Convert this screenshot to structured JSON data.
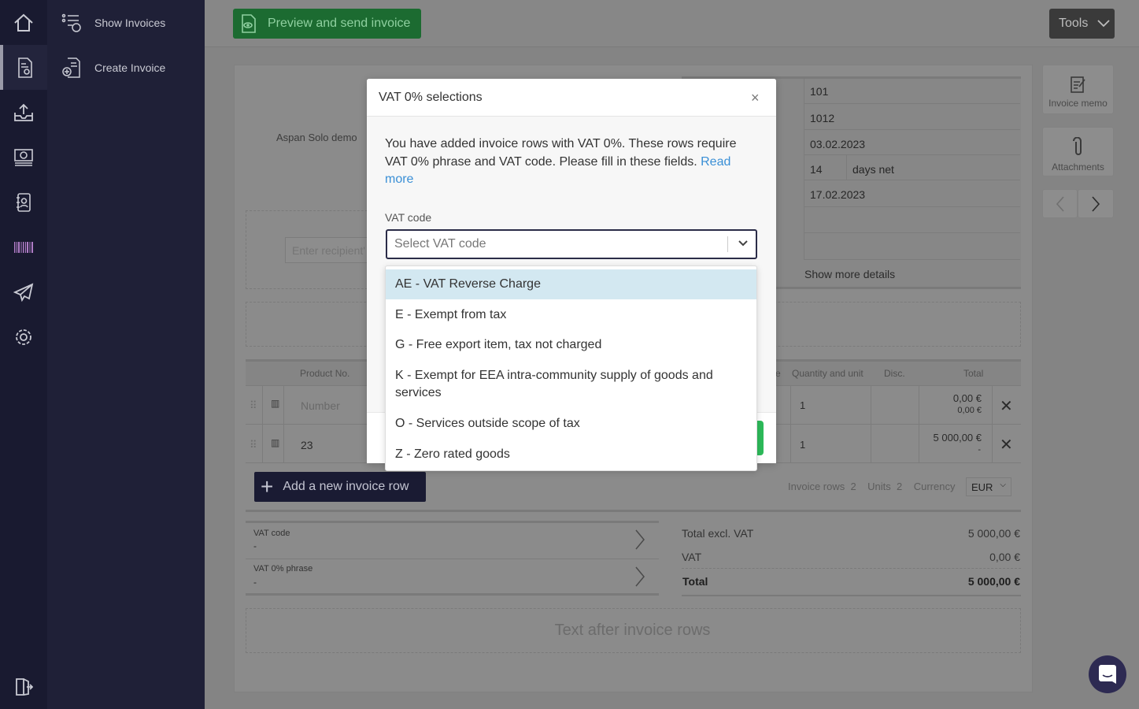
{
  "nav": {
    "rail": [
      "home",
      "invoices",
      "inbox-upload",
      "money",
      "contacts",
      "barcode",
      "send",
      "settings",
      "logout"
    ],
    "submenu": [
      {
        "label": "Show Invoices",
        "icon": "invoice-list-icon"
      },
      {
        "label": "Create Invoice",
        "icon": "create-invoice-icon"
      }
    ]
  },
  "toolbar": {
    "preview_send": "Preview and send invoice",
    "tools": "Tools"
  },
  "invoice": {
    "company": "Aspan Solo demo",
    "recipient_placeholder": "Enter recipient'",
    "meta": [
      "101",
      "1012",
      "03.02.2023",
      "14",
      "17.02.2023",
      "",
      ""
    ],
    "days_net": "days net",
    "show_more": "Show more details",
    "side": {
      "memo": "Invoice memo",
      "attachments": "Attachments"
    },
    "columns": {
      "product_no": "Product No.",
      "partial": "e",
      "quantity": "Quantity and unit",
      "disc": "Disc.",
      "total": "Total"
    },
    "rows": [
      {
        "product": "Number",
        "product_is_placeholder": true,
        "qty": "1",
        "total": "0,00 €",
        "total_sub": "0,00 €"
      },
      {
        "product": "23",
        "qty": "1",
        "total": "5 000,00 €",
        "total_sub": "-"
      }
    ],
    "add_row": "Add a new invoice row",
    "summary": {
      "rows_label": "Invoice rows",
      "rows": "2",
      "units_label": "Units",
      "units": "2",
      "currency_label": "Currency",
      "currency": "EUR"
    },
    "vat_code_label": "VAT code",
    "vat_code_value": "-",
    "vat_phrase_label": "VAT 0% phrase",
    "vat_phrase_value": "-",
    "totals": {
      "excl_label": "Total excl. VAT",
      "excl": "5 000,00 €",
      "vat_label": "VAT",
      "vat": "0,00 €",
      "total_label": "Total",
      "total": "5 000,00 €"
    },
    "text_after": "Text after invoice rows"
  },
  "modal": {
    "title": "VAT 0% selections",
    "body": "You have added invoice rows with VAT 0%. These rows require VAT 0% phrase and VAT code. Please fill in these fields. ",
    "read_more": "Read more",
    "link_color": "#3a8fd6",
    "vat_code_label": "VAT code",
    "select_placeholder": "Select VAT code",
    "options": [
      "AE - VAT Reverse Charge",
      "E - Exempt from tax",
      "G - Free export item, tax not charged",
      "K - Exempt for EEA intra-community supply of goods and services",
      "O - Services outside scope of tax",
      "Z - Zero rated goods"
    ],
    "highlighted_option": 0
  }
}
